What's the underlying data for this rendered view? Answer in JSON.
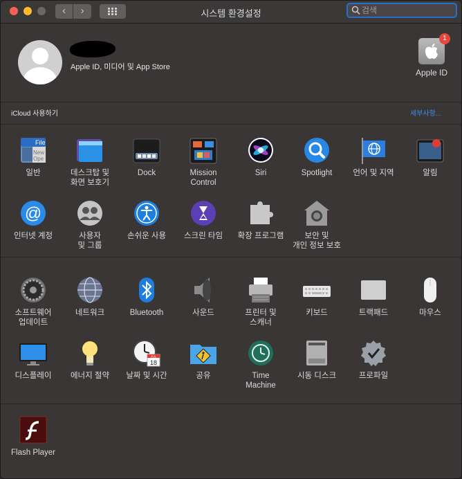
{
  "window": {
    "title": "시스템 환경설정",
    "nav_back": "‹",
    "nav_forward": "›"
  },
  "search": {
    "placeholder": "검색",
    "value": ""
  },
  "account": {
    "subtitle": "Apple ID, 미디어 및 App Store",
    "apple_id_label": "Apple ID",
    "badge_count": "1"
  },
  "icloud": {
    "label": "iCloud 사용하기",
    "details_link": "세부사항..."
  },
  "sections": [
    {
      "items": [
        {
          "label": "일반",
          "icon": "general-icon"
        },
        {
          "label": "데스크탑 및\n화면 보호기",
          "icon": "desktop-screensaver-icon"
        },
        {
          "label": "Dock",
          "icon": "dock-icon"
        },
        {
          "label": "Mission\nControl",
          "icon": "mission-control-icon"
        },
        {
          "label": "Siri",
          "icon": "siri-icon"
        },
        {
          "label": "Spotlight",
          "icon": "spotlight-icon"
        },
        {
          "label": "언어 및 지역",
          "icon": "language-region-icon"
        },
        {
          "label": "알림",
          "icon": "notifications-icon"
        },
        {
          "label": "인터넷 계정",
          "icon": "internet-accounts-icon"
        },
        {
          "label": "사용자\n및 그룹",
          "icon": "users-groups-icon"
        },
        {
          "label": "손쉬운 사용",
          "icon": "accessibility-icon"
        },
        {
          "label": "스크린 타임",
          "icon": "screen-time-icon"
        },
        {
          "label": "확장 프로그램",
          "icon": "extensions-icon"
        },
        {
          "label": "보안 및\n개인 정보 보호",
          "icon": "security-privacy-icon"
        }
      ]
    },
    {
      "items": [
        {
          "label": "소프트웨어\n업데이트",
          "icon": "software-update-icon"
        },
        {
          "label": "네트워크",
          "icon": "network-icon"
        },
        {
          "label": "Bluetooth",
          "icon": "bluetooth-icon"
        },
        {
          "label": "사운드",
          "icon": "sound-icon"
        },
        {
          "label": "프린터 및\n스캐너",
          "icon": "printers-scanners-icon"
        },
        {
          "label": "키보드",
          "icon": "keyboard-icon"
        },
        {
          "label": "트랙패드",
          "icon": "trackpad-icon"
        },
        {
          "label": "마우스",
          "icon": "mouse-icon"
        },
        {
          "label": "디스플레이",
          "icon": "displays-icon"
        },
        {
          "label": "에너지 절약",
          "icon": "energy-saver-icon"
        },
        {
          "label": "날짜 및 시간",
          "icon": "date-time-icon"
        },
        {
          "label": "공유",
          "icon": "sharing-icon"
        },
        {
          "label": "Time\nMachine",
          "icon": "time-machine-icon"
        },
        {
          "label": "시동 디스크",
          "icon": "startup-disk-icon"
        },
        {
          "label": "프로파일",
          "icon": "profiles-icon"
        }
      ]
    },
    {
      "items": [
        {
          "label": "Flash Player",
          "icon": "flash-player-icon"
        }
      ]
    }
  ],
  "icon_glyphs": {
    "general_file": "File",
    "general_new": "New",
    "general_open": "Ope",
    "calendar_month": "JUL",
    "calendar_day": "18"
  }
}
